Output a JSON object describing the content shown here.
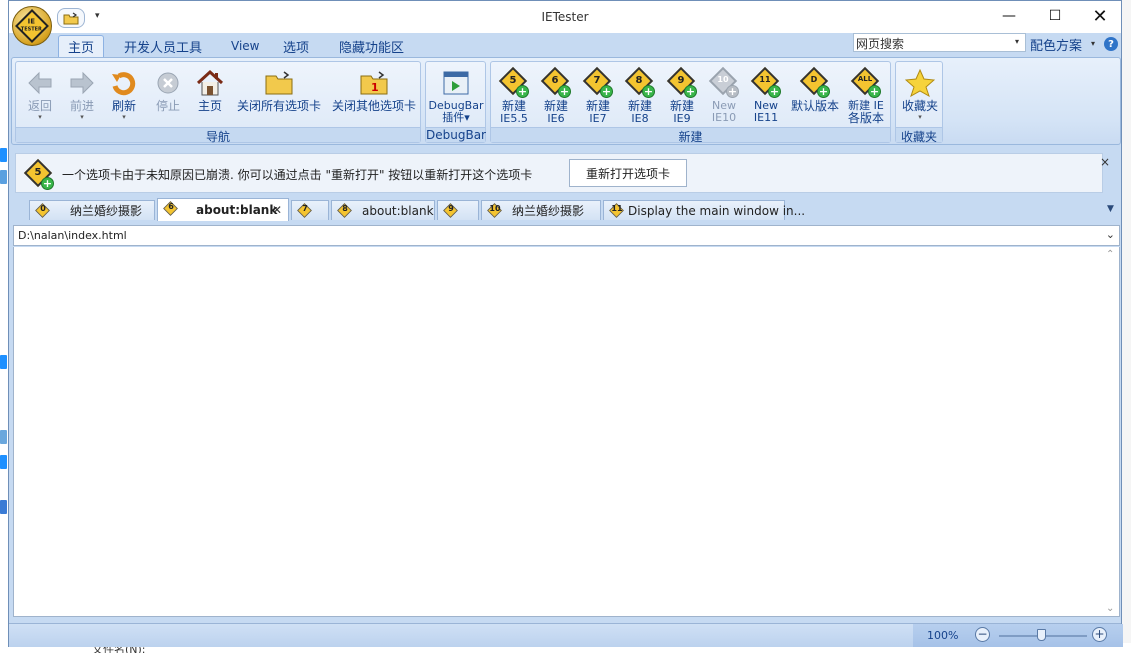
{
  "window": {
    "title": "IETester"
  },
  "app_logo": {
    "line1": "IE",
    "line2": "TESTER"
  },
  "ribbon_tabs": [
    {
      "label": "主页",
      "active": true
    },
    {
      "label": "开发人员工具"
    },
    {
      "label": "View"
    },
    {
      "label": "选项"
    },
    {
      "label": "隐藏功能区"
    }
  ],
  "search": {
    "value": "网页搜索"
  },
  "color_scheme": {
    "label": "配色方案"
  },
  "help": {
    "label": "?"
  },
  "groups": {
    "nav": {
      "label": "导航"
    },
    "debugbar": {
      "label": "DebugBar"
    },
    "new": {
      "label": "新建"
    },
    "favorites": {
      "label": "收藏夹"
    }
  },
  "nav_buttons": {
    "back": "返回",
    "forward": "前进",
    "refresh": "刷新",
    "stop": "停止",
    "home": "主页",
    "close_all": "关闭所有选项卡",
    "close_others": "关闭其他选项卡"
  },
  "debugbar_button": {
    "line1": "DebugBar",
    "line2": "插件"
  },
  "new_buttons": [
    {
      "num": "5",
      "line1": "新建",
      "line2": "IE5.5"
    },
    {
      "num": "6",
      "line1": "新建",
      "line2": "IE6"
    },
    {
      "num": "7",
      "line1": "新建",
      "line2": "IE7"
    },
    {
      "num": "8",
      "line1": "新建",
      "line2": "IE8"
    },
    {
      "num": "9",
      "line1": "新建",
      "line2": "IE9"
    },
    {
      "num": "10",
      "line1": "New",
      "line2": "IE10"
    },
    {
      "num": "11",
      "line1": "New",
      "line2": "IE11"
    },
    {
      "num": "D",
      "line1": "默认版本",
      "line2": ""
    },
    {
      "num": "ALL",
      "line1": "新建 IE",
      "line2": "各版本"
    }
  ],
  "favorites_button": {
    "label": "收藏夹"
  },
  "infobar": {
    "icon_num": "5",
    "message": "一个选项卡由于未知原因已崩溃. 你可以通过点击 \"重新打开\" 按钮以重新打开这个选项卡",
    "reopen_label": "重新打开选项卡",
    "close": "×"
  },
  "doc_tabs": [
    {
      "num": "0",
      "label": "纳兰婚纱摄影"
    },
    {
      "num": "6",
      "label": "about:blank",
      "active": true
    },
    {
      "num": "7",
      "label": ""
    },
    {
      "num": "8",
      "label": "about:blank"
    },
    {
      "num": "9",
      "label": ""
    },
    {
      "num": "10",
      "label": "纳兰婚纱摄影"
    },
    {
      "num": "11",
      "label": "Display the main window in..."
    }
  ],
  "address": {
    "value": "D:\\nalan\\index.html"
  },
  "status": {
    "zoom": "100%"
  },
  "background": {
    "file_label": "文件名(N):"
  }
}
